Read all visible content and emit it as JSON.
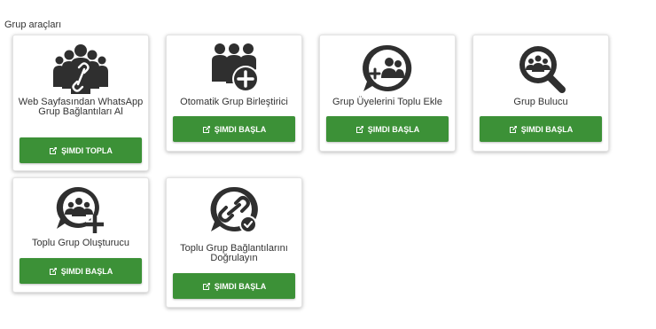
{
  "section": {
    "title": "Grup araçları"
  },
  "tools": [
    {
      "label": "Web Sayfasından WhatsApp Grup Bağlantıları Al",
      "button": "ŞIMDI TOPLA",
      "icon": "group-link-icon"
    },
    {
      "label": "Otomatik Grup Birleştirici",
      "button": "ŞIMDI BAŞLA",
      "icon": "group-merge-icon"
    },
    {
      "label": "Grup Üyelerini Toplu Ekle",
      "button": "ŞIMDI BAŞLA",
      "icon": "add-members-icon"
    },
    {
      "label": "Grup Bulucu",
      "button": "ŞIMDI BAŞLA",
      "icon": "group-search-icon"
    },
    {
      "label": "Toplu Grup Oluşturucu",
      "button": "ŞIMDI BAŞLA",
      "icon": "create-group-icon"
    },
    {
      "label": "Toplu Grup Bağlantılarını Doğrulayın",
      "button": "ŞIMDI BAŞLA",
      "icon": "verify-links-icon"
    }
  ],
  "colors": {
    "button": "#3c9137",
    "icon": "#2f2f2f",
    "text": "#333333"
  }
}
